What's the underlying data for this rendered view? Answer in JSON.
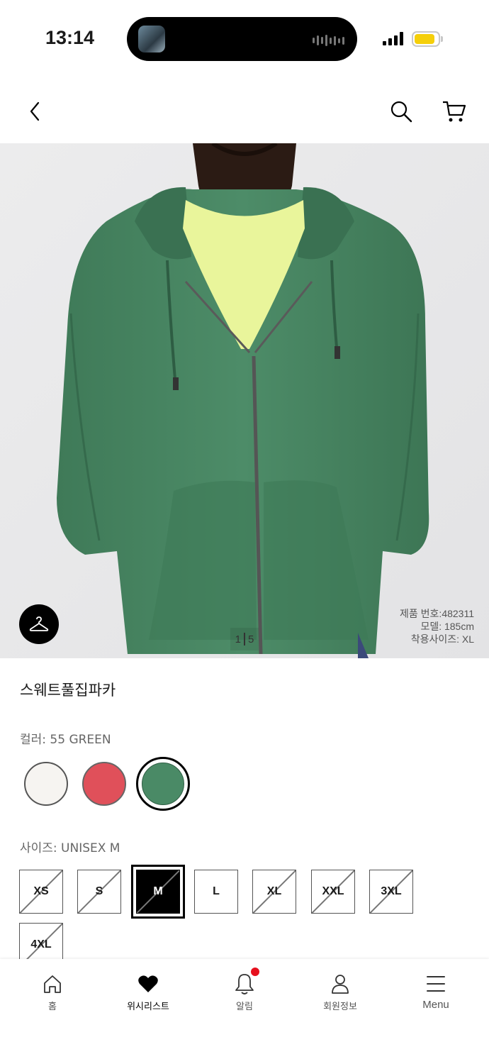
{
  "status_bar": {
    "time": "13:14"
  },
  "product": {
    "name": "스웨트풀집파카",
    "image_counter": {
      "current": "1",
      "total": "5"
    },
    "meta": [
      "제품 번호:482311",
      "모델: 185cm",
      "착용사이즈: XL"
    ]
  },
  "color": {
    "label": "컬러: 55 GREEN",
    "options": [
      {
        "name": "white",
        "hex": "#f6f4f1"
      },
      {
        "name": "red",
        "hex": "#e0505a"
      },
      {
        "name": "green",
        "hex": "#4a8a66",
        "selected": true
      }
    ]
  },
  "size": {
    "label": "사이즈: UNISEX M",
    "options": [
      {
        "label": "XS",
        "available": false
      },
      {
        "label": "S",
        "available": false
      },
      {
        "label": "M",
        "available": false,
        "selected": true
      },
      {
        "label": "L",
        "available": true
      },
      {
        "label": "XL",
        "available": false
      },
      {
        "label": "XXL",
        "available": false
      },
      {
        "label": "3XL",
        "available": false
      },
      {
        "label": "4XL",
        "available": false
      }
    ]
  },
  "tabbar": {
    "home": "홈",
    "wishlist": "위시리스트",
    "notifications": "알림",
    "account": "회원정보",
    "menu": "Menu"
  },
  "icons": [
    "back-icon",
    "search-icon",
    "cart-icon",
    "hanger-icon",
    "home-icon",
    "heart-icon",
    "bell-icon",
    "person-icon",
    "menu-icon"
  ],
  "colors": {
    "accent": "#000000",
    "notification_dot": "#e6101e"
  }
}
